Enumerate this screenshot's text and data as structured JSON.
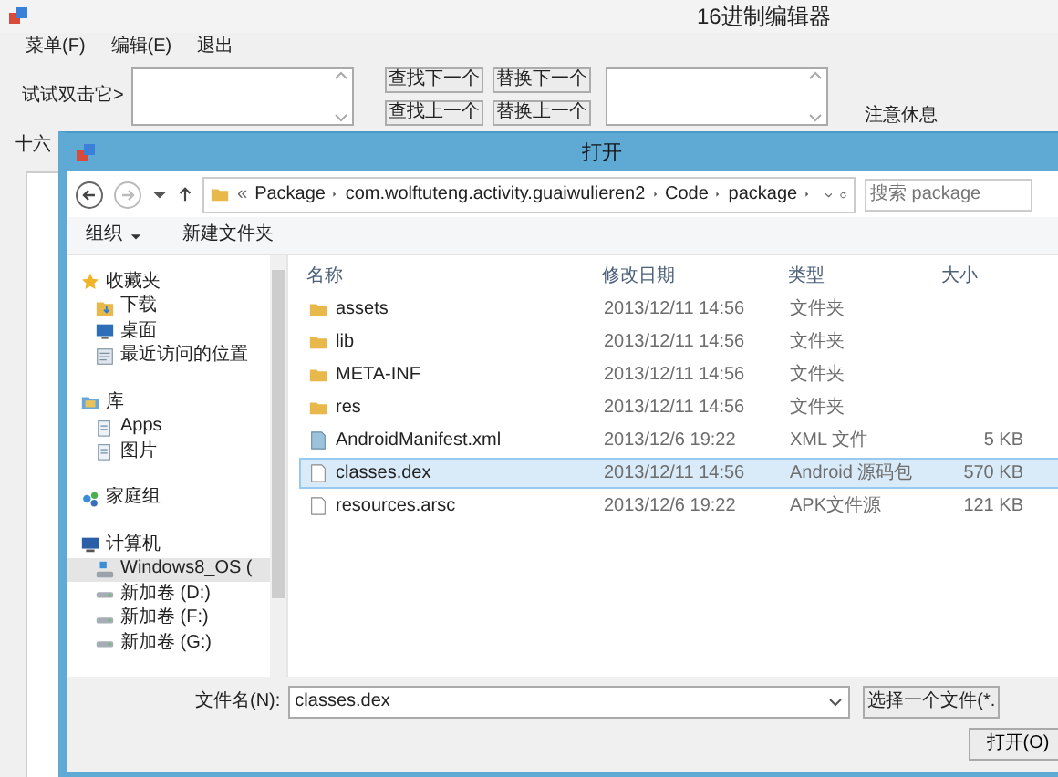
{
  "window": {
    "title": "16进制编辑器"
  },
  "menu": [
    {
      "label": "菜单(F)"
    },
    {
      "label": "编辑(E)"
    },
    {
      "label": "退出"
    }
  ],
  "search_label": "试试双击它>",
  "buttons": [
    {
      "label": "查找下一个"
    },
    {
      "label": "查找上一个"
    },
    {
      "label": "替换下一个"
    },
    {
      "label": "替换上一个"
    }
  ],
  "notice": "注意休息",
  "hex_label": "十六",
  "dialog": {
    "title": "打开",
    "breadcrumb_overflow": "«",
    "breadcrumb": [
      "Package",
      "com.wolftuteng.activity.guaiwulieren2",
      "Code",
      "package"
    ],
    "search": {
      "placeholder": "搜索 package"
    },
    "toolbar": [
      {
        "label": "组织",
        "dropdown": true
      },
      {
        "label": "新建文件夹",
        "dropdown": false
      }
    ],
    "nav": [
      {
        "label": "收藏夹",
        "kind": "star",
        "selected": false,
        "children": [
          {
            "label": "下载",
            "kind": "download",
            "selected": false
          },
          {
            "label": "桌面",
            "kind": "desktop",
            "selected": false
          },
          {
            "label": "最近访问的位置",
            "kind": "recent",
            "selected": false
          }
        ]
      },
      {
        "label": "库",
        "kind": "library",
        "selected": false,
        "children": [
          {
            "label": "Apps",
            "kind": "document",
            "selected": false
          },
          {
            "label": "图片",
            "kind": "document",
            "selected": false
          }
        ]
      },
      {
        "label": "家庭组",
        "kind": "homegroup",
        "selected": false
      },
      {
        "label": "计算机",
        "kind": "computer",
        "selected": false,
        "children": [
          {
            "label": "Windows8_OS (",
            "kind": "system-drive",
            "selected": true
          },
          {
            "label": "新加卷 (D:)",
            "kind": "drive",
            "selected": false
          },
          {
            "label": "新加卷 (F:)",
            "kind": "drive",
            "selected": false
          },
          {
            "label": "新加卷 (G:)",
            "kind": "drive",
            "selected": false
          }
        ]
      }
    ],
    "columns": [
      "名称",
      "修改日期",
      "类型",
      "大小"
    ],
    "files": [
      {
        "name": "assets",
        "date": "2013/12/11 14:56",
        "type": "文件夹",
        "kind": "folder",
        "selected": false
      },
      {
        "name": "lib",
        "date": "2013/12/11 14:56",
        "type": "文件夹",
        "kind": "folder",
        "selected": false
      },
      {
        "name": "META-INF",
        "date": "2013/12/11 14:56",
        "type": "文件夹",
        "kind": "folder",
        "selected": false
      },
      {
        "name": "res",
        "date": "2013/12/11 14:56",
        "type": "文件夹",
        "kind": "folder",
        "selected": false
      },
      {
        "name": "AndroidManifest.xml",
        "date": "2013/12/6 19:22",
        "type": "XML 文件",
        "size": "5 KB",
        "kind": "xml",
        "selected": false
      },
      {
        "name": "classes.dex",
        "date": "2013/12/11 14:56",
        "type": "Android 源码包",
        "size": "570 KB",
        "kind": "file",
        "selected": true
      },
      {
        "name": "resources.arsc",
        "date": "2013/12/6 19:22",
        "type": "APK文件源",
        "size": "121 KB",
        "kind": "file",
        "selected": false
      }
    ],
    "file_name": {
      "label": "文件名(N):",
      "value": "classes.dex"
    },
    "filter": "选择一个文件(*.",
    "open_button": "打开(O)"
  }
}
